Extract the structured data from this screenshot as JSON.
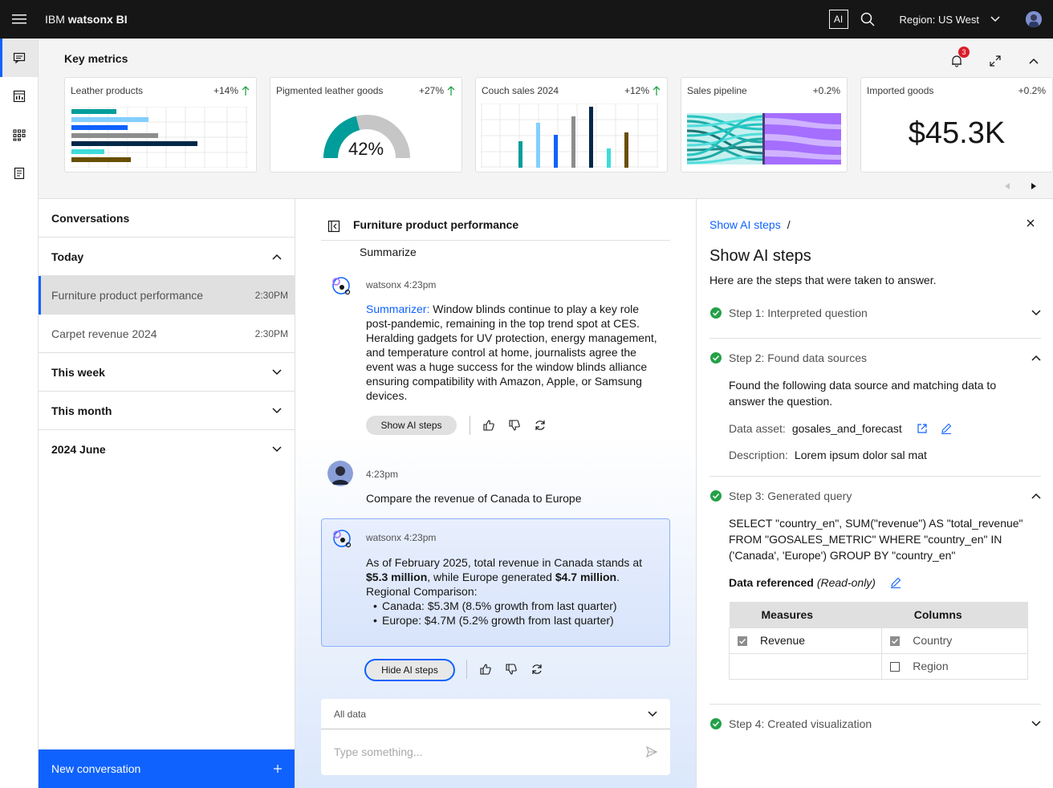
{
  "header": {
    "brand_prefix": "IBM ",
    "brand_product": "watsonx BI",
    "ai_badge": "AI",
    "region": "Region: US West"
  },
  "key_metrics": {
    "title": "Key metrics",
    "notification_count": "3",
    "cards": [
      {
        "label": "Leather products",
        "delta": "+14%",
        "trend": "up",
        "chart": "horizontal-bar"
      },
      {
        "label": "Pigmented leather goods",
        "delta": "+27%",
        "trend": "up",
        "gauge_value": "42%",
        "gauge_fraction": 0.42
      },
      {
        "label": "Couch sales 2024",
        "delta": "+12%",
        "trend": "up",
        "chart": "bar"
      },
      {
        "label": "Sales pipeline",
        "delta": "+0.2%",
        "chart": "sankey"
      },
      {
        "label": "Imported goods",
        "delta": "+0.2%",
        "value": "$45.3K"
      }
    ]
  },
  "conversations": {
    "title": "Conversations",
    "groups": [
      {
        "label": "Today",
        "expanded": true
      },
      {
        "label": "This week",
        "expanded": false
      },
      {
        "label": "This month",
        "expanded": false
      },
      {
        "label": "2024 June",
        "expanded": false
      }
    ],
    "items": [
      {
        "title": "Furniture product performance",
        "time": "2:30PM",
        "active": true
      },
      {
        "title": "Carpet revenue 2024",
        "time": "2:30PM",
        "active": false
      }
    ],
    "new_button": "New conversation"
  },
  "chat": {
    "title": "Furniture product performance",
    "prev_prompt": "Summarize",
    "msg1": {
      "meta": "watsonx 4:23pm",
      "highlight": "Summarizer:",
      "text": " Window blinds continue to play a key role post-pandemic, remaining in the top trend spot at CES. Heralding gadgets for UV protection, energy management, and temperature control at home, journalists agree the event was a huge success for the window blinds alliance ensuring compatibility with Amazon, Apple, or Samsung devices.",
      "button": "Show AI steps"
    },
    "msg2": {
      "meta": "4:23pm",
      "text": "Compare the revenue of Canada to Europe"
    },
    "msg3": {
      "meta": "watsonx 4:23pm",
      "p1": "As of February 2025, total revenue in Canada stands at ",
      "b1": "$5.3 million",
      "p2": ", while Europe generated ",
      "b2": "$4.7 million",
      "p3": ".",
      "p4": "Regional Comparison:",
      "bullets": [
        "Canada: $5.3M (8.5% growth from last quarter)",
        "Europe: $4.7M (5.2% growth from last quarter)"
      ],
      "button": "Hide AI steps"
    },
    "input": {
      "scope": "All data",
      "placeholder": "Type something..."
    }
  },
  "ai_steps": {
    "breadcrumb": "Show AI steps",
    "breadcrumb_sep": "/",
    "title": "Show AI steps",
    "subtitle": "Here are the steps that were taken to answer.",
    "steps": [
      {
        "label": "Step 1: Interpreted question",
        "expanded": false
      },
      {
        "label": "Step 2: Found data sources",
        "expanded": true
      },
      {
        "label": "Step 3: Generated query",
        "expanded": true
      },
      {
        "label": "Step 4: Created visualization",
        "expanded": false
      }
    ],
    "step2": {
      "text": "Found the following data source and matching data to answer the question.",
      "asset_key": "Data asset:",
      "asset_val": "gosales_and_forecast",
      "desc_key": "Description:",
      "desc_val": "Lorem ipsum dolor sal mat"
    },
    "step3": {
      "query": "SELECT \"country_en\", SUM(\"revenue\") AS \"total_revenue\" FROM \"GOSALES_METRIC\" WHERE \"country_en\" IN ('Canada', 'Europe') GROUP BY \"country_en\"",
      "ref_label": "Data referenced",
      "ref_note": "(Read-only)",
      "table": {
        "headers": [
          "Measures",
          "Columns"
        ],
        "rows": [
          [
            {
              "label": "Revenue",
              "checked": true
            },
            {
              "label": "Country",
              "checked": true
            }
          ],
          [
            {
              "label": "",
              "checked": null
            },
            {
              "label": "Region",
              "checked": false
            }
          ]
        ]
      }
    }
  },
  "colors": {
    "accent": "#0f62fe",
    "success": "#24a148",
    "topbar": "#161616"
  }
}
